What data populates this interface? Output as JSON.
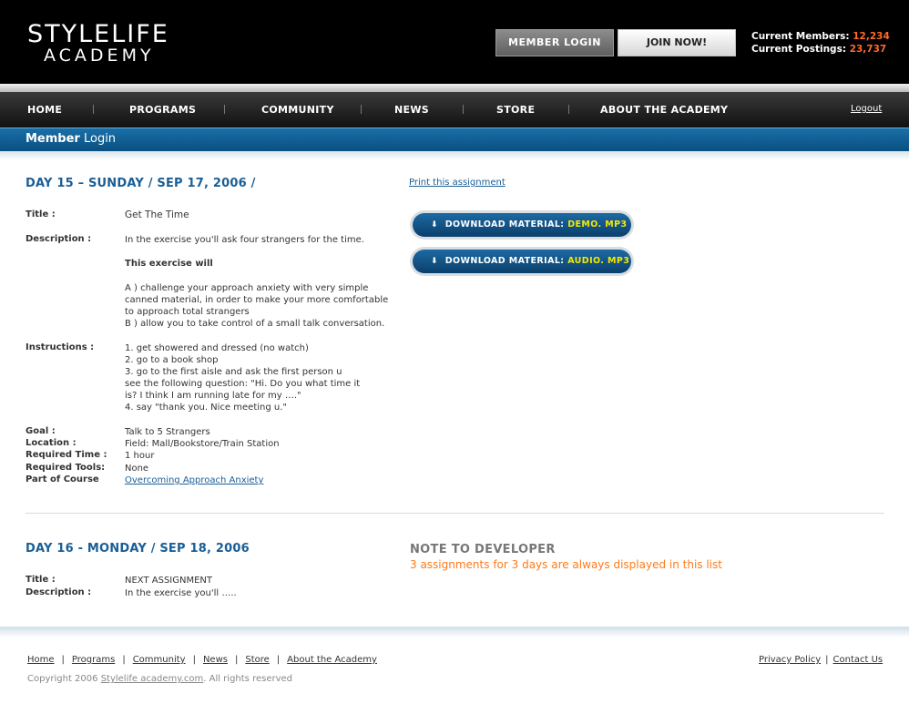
{
  "header": {
    "logo_line1": "STYLELIFE",
    "logo_line2": "ACADEMY",
    "member_login_button": "MEMBER  LOGIN",
    "join_button": "JOIN NOW!",
    "members_label": "Current Members:",
    "members_value": "12,234",
    "postings_label": "Current Postings:",
    "postings_value": "23,737"
  },
  "nav": {
    "items": [
      "HOME",
      "PROGRAMS",
      "COMMUNITY",
      "NEWS",
      "STORE",
      "ABOUT THE ACADEMY"
    ],
    "logout": "Logout"
  },
  "subbar": {
    "title_bold": "Member",
    "title_rest": " Login"
  },
  "day15": {
    "heading": "DAY 15 – SUNDAY / SEP 17, 2006 /",
    "title_label": "Title :",
    "title_value": "Get The Time",
    "description_label": "Description :",
    "description_text": "In the exercise you'll ask four strangers for the time.",
    "exercise_will": "This exercise will",
    "point_a_1": "A )  challenge your approach anxiety with very simple",
    "point_a_2": "canned material, in order to make your more comfortable",
    "point_a_3": "to approach total strangers",
    "point_b": "B )  allow you to take control of a small talk conversation.",
    "instructions_label": "Instructions :",
    "instr_1": "1.    get showered and dressed (no watch)",
    "instr_2": "2.    go to a book shop",
    "instr_3": "3.    go to the first aisle and ask the first person u",
    "instr_3b": "see the following question: \"Hi. Do you what time it",
    "instr_3c": "is? I think I am running late for my ….\"",
    "instr_4": "4.    say \"thank you. Nice meeting u.\"",
    "goal_label": "Goal :",
    "goal_value": "Talk to 5 Strangers",
    "location_label": "Location :",
    "location_value": "Field: Mall/Bookstore/Train Station",
    "time_label": "Required Time :",
    "time_value": "1 hour",
    "tools_label": "Required Tools:",
    "tools_value": "None",
    "course_label": "Part of Course",
    "course_value": "Overcoming Approach Anxiety",
    "print_link": "Print this assignment",
    "download_prefix": "DOWNLOAD MATERIAL:",
    "download_demo": "DEMO. MP3",
    "download_audio": "AUDIO. MP3"
  },
  "day16": {
    "heading": "DAY 16 - MONDAY / SEP 18, 2006",
    "title_label": "Title :",
    "title_value": "NEXT ASSIGNMENT",
    "description_label": "Description :",
    "description_text": "In the exercise you'll …..",
    "note_title": "NOTE TO DEVELOPER",
    "note_body": "3 assignments for 3 days are always displayed in this list"
  },
  "footer": {
    "links": [
      "Home",
      "Programs",
      "Community",
      "News",
      "Store",
      "About the Academy"
    ],
    "privacy": "Privacy Policy",
    "contact": "Contact Us",
    "copyright_pre": "Copyright 2006",
    "copyright_site": "Stylelife academy.com",
    "copyright_post": ".  All rights reserved"
  },
  "colors": {
    "accent_blue": "#1a5e96",
    "stat_orange": "#ff6a2b",
    "note_orange": "#ff7a1a",
    "highlight_yellow": "#f6e800"
  }
}
